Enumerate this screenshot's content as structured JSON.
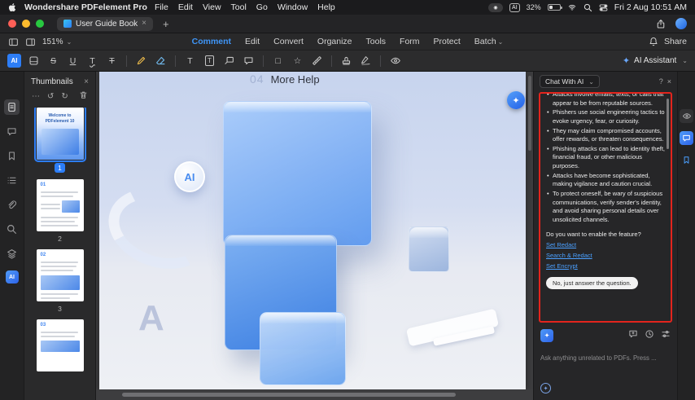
{
  "menubar": {
    "app_name": "Wondershare PDFelement Pro",
    "menus": [
      "File",
      "Edit",
      "View",
      "Tool",
      "Go",
      "Window",
      "Help"
    ],
    "status": {
      "ai_badge": "AI",
      "battery_pct": "32%",
      "clock": "Fri 2 Aug 10:51 AM"
    }
  },
  "tabbar": {
    "tab_title": "User Guide Book"
  },
  "toolbar": {
    "zoom": "151%",
    "tabs": [
      "Comment",
      "Edit",
      "Convert",
      "Organize",
      "Tools",
      "Form",
      "Protect",
      "Batch"
    ],
    "active_tab": "Comment",
    "share_label": "Share",
    "ai_assistant_label": "AI Assistant",
    "ai_tool_label": "AI"
  },
  "thumbnails": {
    "title": "Thumbnails",
    "page1_title": "Welcome to PDFelement 10",
    "labels": [
      "1",
      "2",
      "3"
    ],
    "page_heads": [
      "01",
      "02",
      "03"
    ]
  },
  "canvas": {
    "watermark": "04",
    "page_title": "More Help",
    "ai_logo": "AI",
    "letter_a": "A"
  },
  "chat": {
    "header": "Chat With AI",
    "bullets": [
      "Attacks involve emails, texts, or calls that appear to be from reputable sources.",
      "Phishers use social engineering tactics to evoke urgency, fear, or curiosity.",
      "They may claim compromised accounts, offer rewards, or threaten consequences.",
      "Phishing attacks can lead to identity theft, financial fraud, or other malicious purposes.",
      "Attacks have become sophisticated, making vigilance and caution crucial.",
      "To protect oneself, be wary of suspicious communications, verify sender's identity, and avoid sharing personal details over unsolicited channels."
    ],
    "question": "Do you want to enable the feature?",
    "links": [
      "Set Redact",
      "Search & Redact",
      "Set Encrypt"
    ],
    "decline_chip": "No, just answer the question.",
    "input_placeholder": "Ask anything unrelated to PDFs. Press ..."
  },
  "icons": {
    "close": "×",
    "chevron_down": "⌄",
    "more": "⋯",
    "rotate_left": "↺",
    "rotate_right": "↻",
    "add_tab": "+",
    "help": "?",
    "record_dot": "◉",
    "sparkle": "✦",
    "star": "☆",
    "square": "□",
    "text_t": "T",
    "letter_s": "S",
    "letter_u": "U",
    "eye_dot": "◉"
  },
  "colors": {
    "accent": "#2d7ef7",
    "alert_border": "#e3241d",
    "link": "#4ba0ff",
    "active_tab_text": "#3f96f8"
  }
}
